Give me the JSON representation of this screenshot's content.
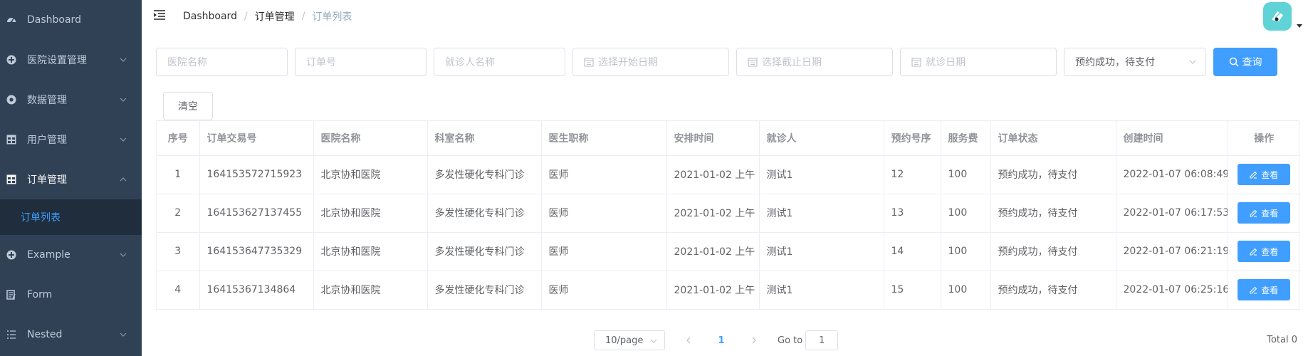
{
  "sidebar": {
    "items": [
      {
        "label": "Dashboard",
        "icon": "dashboard-icon",
        "has_arrow": false
      },
      {
        "label": "医院设置管理",
        "icon": "plus-circle-icon",
        "has_arrow": true
      },
      {
        "label": "数据管理",
        "icon": "life-ring-icon",
        "has_arrow": true
      },
      {
        "label": "用户管理",
        "icon": "table-grid-icon",
        "has_arrow": true
      },
      {
        "label": "订单管理",
        "icon": "table-grid-icon",
        "has_arrow": true,
        "expanded": true
      },
      {
        "label": "订单列表",
        "sub": true,
        "active": true
      },
      {
        "label": "Example",
        "icon": "plus-circle-icon",
        "has_arrow": true
      },
      {
        "label": "Form",
        "icon": "form-icon",
        "has_arrow": false
      },
      {
        "label": "Nested",
        "icon": "nested-list-icon",
        "has_arrow": true
      }
    ]
  },
  "breadcrumb": {
    "items": [
      "Dashboard",
      "订单管理"
    ],
    "current": "订单列表"
  },
  "filters": {
    "hospital_name_placeholder": "医院名称",
    "order_no_placeholder": "订单号",
    "patient_name_placeholder": "就诊人名称",
    "start_date_placeholder": "选择开始日期",
    "end_date_placeholder": "选择截止日期",
    "visit_date_placeholder": "就诊日期",
    "status_value": "预约成功，待支付",
    "search_label": "查询",
    "clear_label": "清空"
  },
  "table": {
    "headers": {
      "index": "序号",
      "order_no": "订单交易号",
      "hospital": "医院名称",
      "department": "科室名称",
      "title": "医生职称",
      "schedule": "安排时间",
      "patient": "就诊人",
      "number": "预约号序",
      "fee": "服务费",
      "status": "订单状态",
      "created": "创建时间",
      "actions": "操作"
    },
    "rows": [
      {
        "index": "1",
        "order_no": "164153572715923",
        "hospital": "北京协和医院",
        "department": "多发性硬化专科门诊",
        "title": "医师",
        "schedule": "2021-01-02 上午",
        "patient": "测试1",
        "number": "12",
        "fee": "100",
        "status": "预约成功，待支付",
        "created": "2022-01-07 06:08:49",
        "action": "查看"
      },
      {
        "index": "2",
        "order_no": "164153627137455",
        "hospital": "北京协和医院",
        "department": "多发性硬化专科门诊",
        "title": "医师",
        "schedule": "2021-01-02 上午",
        "patient": "测试1",
        "number": "13",
        "fee": "100",
        "status": "预约成功，待支付",
        "created": "2022-01-07 06:17:53",
        "action": "查看"
      },
      {
        "index": "3",
        "order_no": "164153647735329",
        "hospital": "北京协和医院",
        "department": "多发性硬化专科门诊",
        "title": "医师",
        "schedule": "2021-01-02 上午",
        "patient": "测试1",
        "number": "14",
        "fee": "100",
        "status": "预约成功，待支付",
        "created": "2022-01-07 06:21:19",
        "action": "查看"
      },
      {
        "index": "4",
        "order_no": "16415367134864",
        "hospital": "北京协和医院",
        "department": "多发性硬化专科门诊",
        "title": "医师",
        "schedule": "2021-01-02 上午",
        "patient": "测试1",
        "number": "15",
        "fee": "100",
        "status": "预约成功，待支付",
        "created": "2022-01-07 06:25:16",
        "action": "查看"
      }
    ]
  },
  "pagination": {
    "page_size": "10/page",
    "current_page": "1",
    "goto_label": "Go to",
    "goto_value": "1",
    "total": "Total 0"
  },
  "colors": {
    "sidebar_bg": "#304156",
    "primary": "#409eff",
    "avatar_bg": "#5fd3d6"
  }
}
